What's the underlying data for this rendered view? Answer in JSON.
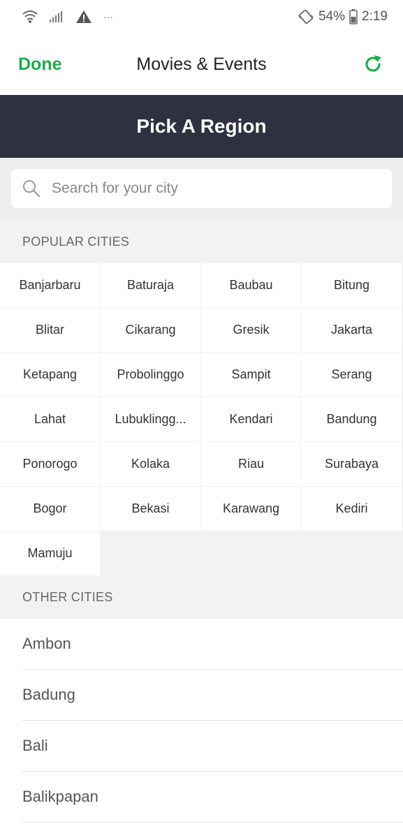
{
  "status_bar": {
    "icons": [
      "wifi-icon",
      "signal-icon",
      "warning-icon",
      "more-dots-icon"
    ],
    "dots": "···",
    "battery_percent": "54%",
    "time": "2:19"
  },
  "topbar": {
    "done_label": "Done",
    "title": "Movies & Events",
    "refresh_icon": "refresh-icon",
    "accent_color": "#1faa4d"
  },
  "region_header": {
    "title": "Pick A Region",
    "background": "#2e3140"
  },
  "search": {
    "placeholder": "Search for your city",
    "value": ""
  },
  "popular": {
    "header": "POPULAR CITIES",
    "cities": [
      "Banjarbaru",
      "Baturaja",
      "Baubau",
      "Bitung",
      "Blitar",
      "Cikarang",
      "Gresik",
      "Jakarta",
      "Ketapang",
      "Probolinggo",
      "Sampit",
      "Serang",
      "Lahat",
      "Lubuklingg...",
      "Kendari",
      "Bandung",
      "Ponorogo",
      "Kolaka",
      "Riau",
      "Surabaya",
      "Bogor",
      "Bekasi",
      "Karawang",
      "Kediri",
      "Mamuju"
    ]
  },
  "other": {
    "header": "OTHER CITIES",
    "cities": [
      "Ambon",
      "Badung",
      "Bali",
      "Balikpapan"
    ]
  }
}
